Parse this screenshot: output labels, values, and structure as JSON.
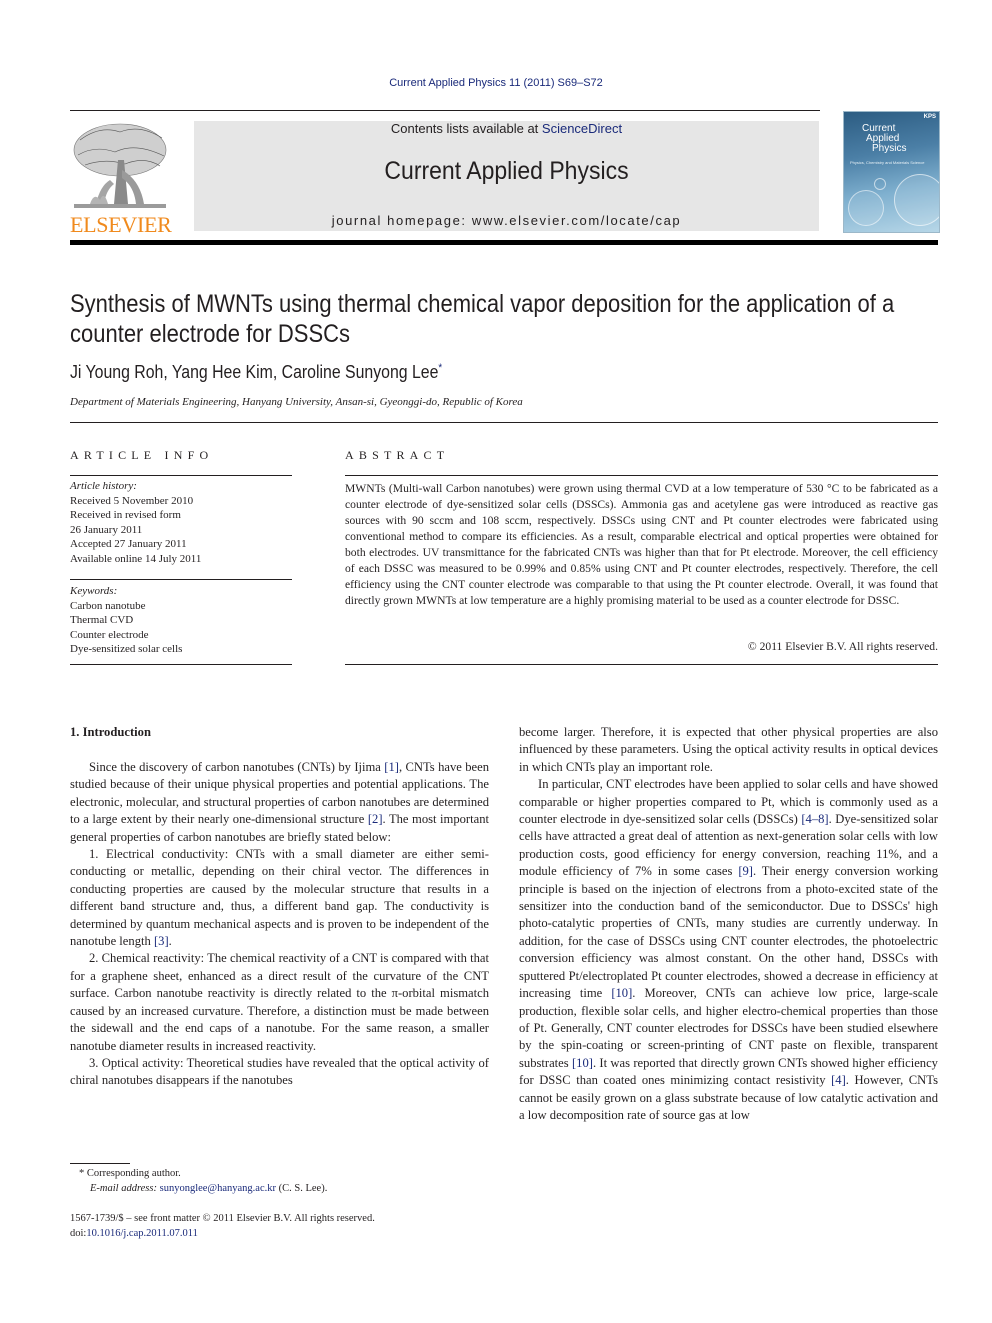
{
  "citation": "Current Applied Physics 11 (2011) S69–S72",
  "masthead": {
    "publisher_logo_text": "ELSEVIER",
    "contents_prefix": "Contents lists available at ",
    "contents_link": "ScienceDirect",
    "journal_title": "Current Applied Physics",
    "homepage_line": "journal homepage: www.elsevier.com/locate/cap",
    "cover": {
      "title_lines": [
        "Current",
        "Applied",
        "Physics"
      ],
      "subtitle": "Physics, Chemistry and Materials Science",
      "badge": "KPS"
    }
  },
  "article": {
    "title": "Synthesis of MWNTs using thermal chemical vapor deposition for the application of a counter electrode for DSSCs",
    "authors": "Ji Young Roh, Yang Hee Kim, Caroline Sunyong Lee",
    "corresponding_mark": "*",
    "affiliation": "Department of Materials Engineering, Hanyang University, Ansan-si, Gyeonggi-do, Republic of Korea"
  },
  "article_info": {
    "label": "ARTICLE INFO",
    "history_header": "Article history:",
    "history": [
      "Received 5 November 2010",
      "Received in revised form",
      "26 January 2011",
      "Accepted 27 January 2011",
      "Available online 14 July 2011"
    ],
    "keywords_header": "Keywords:",
    "keywords": [
      "Carbon nanotube",
      "Thermal CVD",
      "Counter electrode",
      "Dye-sensitized solar cells"
    ]
  },
  "abstract": {
    "label": "ABSTRACT",
    "text": "MWNTs (Multi-wall Carbon nanotubes) were grown using thermal CVD at a low temperature of 530 °C to be fabricated as a counter electrode of dye-sensitized solar cells (DSSCs). Ammonia gas and acetylene gas were introduced as reactive gas sources with 90 sccm and 108 sccm, respectively. DSSCs using CNT and Pt counter electrodes were fabricated using conventional method to compare its efficiencies. As a result, comparable electrical and optical properties were obtained for both electrodes. UV transmittance for the fabricated CNTs was higher than that for Pt electrode. Moreover, the cell efficiency of each DSSC was measured to be 0.99% and 0.85% using CNT and Pt counter electrodes, respectively. Therefore, the cell efficiency using the CNT counter electrode was comparable to that using the Pt counter electrode. Overall, it was found that directly grown MWNTs at low temperature are a highly promising material to be used as a counter electrode for DSSC.",
    "copyright": "© 2011 Elsevier B.V. All rights reserved."
  },
  "introduction": {
    "heading": "1.  Introduction",
    "left_column": [
      {
        "parts": [
          {
            "t": "Since the discovery of carbon nanotubes (CNTs) by Ijima "
          },
          {
            "ref": "[1]"
          },
          {
            "t": ", CNTs have been studied because of their unique physical properties and potential applications. The electronic, molecular, and structural properties of carbon nanotubes are determined to a large extent by their nearly one-dimensional structure "
          },
          {
            "ref": "[2]"
          },
          {
            "t": ". The most important general properties of carbon nanotubes are briefly stated below:"
          }
        ]
      },
      {
        "parts": [
          {
            "t": "1. Electrical conductivity: CNTs with a small diameter are either semi-conducting or metallic, depending on their chiral vector. The differences in conducting properties are caused by the molecular structure that results in a different band structure and, thus, a different band gap. The conductivity is determined by quantum mechanical aspects and is proven to be independent of the nanotube length "
          },
          {
            "ref": "[3]"
          },
          {
            "t": "."
          }
        ]
      },
      {
        "parts": [
          {
            "t": "2. Chemical reactivity: The chemical reactivity of a CNT is compared with that for a graphene sheet, enhanced as a direct result of the curvature of the CNT surface. Carbon nanotube reactivity is directly related to the π-orbital mismatch caused by an increased curvature. Therefore, a distinction must be made between the sidewall and the end caps of a nanotube. For the same reason, a smaller nanotube diameter results in increased reactivity."
          }
        ]
      },
      {
        "parts": [
          {
            "t": "3. Optical activity: Theoretical studies have revealed that the optical activity of chiral nanotubes disappears if the nanotubes"
          }
        ]
      }
    ],
    "right_column": [
      {
        "noindent": true,
        "parts": [
          {
            "t": "become larger. Therefore, it is expected that other physical properties are also influenced by these parameters. Using the optical activity results in optical devices in which CNTs play an important role."
          }
        ]
      },
      {
        "parts": [
          {
            "t": "In particular, CNT electrodes have been applied to solar cells and have showed comparable or higher properties compared to Pt, which is commonly used as a counter electrode in dye-sensitized solar cells (DSSCs) "
          },
          {
            "ref": "[4–8]"
          },
          {
            "t": ". Dye-sensitized solar cells have attracted a great deal of attention as next-generation solar cells with low production costs, good efficiency for energy conversion, reaching 11%, and a module efficiency of 7% in some cases "
          },
          {
            "ref": "[9]"
          },
          {
            "t": ". Their energy conversion working principle is based on the injection of electrons from a photo-excited state of the sensitizer into the conduction band of the semiconductor. Due to DSSCs' high photo-catalytic properties of CNTs, many studies are currently underway. In addition, for the case of DSSCs using CNT counter electrodes, the photoelectric conversion efficiency was almost constant. On the other hand, DSSCs with sputtered Pt/electroplated Pt counter electrodes, showed a decrease in efficiency at increasing time "
          },
          {
            "ref": "[10]"
          },
          {
            "t": ". Moreover, CNTs can achieve low price, large-scale production, flexible solar cells, and higher electro-chemical properties than those of Pt. Generally, CNT counter electrodes for DSSCs have been studied elsewhere by the spin-coating or screen-printing of CNT paste on flexible, transparent substrates "
          },
          {
            "ref": "[10]"
          },
          {
            "t": ". It was reported that directly grown CNTs showed higher efficiency for DSSC than coated ones minimizing contact resistivity "
          },
          {
            "ref": "[4]"
          },
          {
            "t": ". However, CNTs cannot be easily grown on a glass substrate because of low catalytic activation and a low decomposition rate of source gas at low"
          }
        ]
      }
    ]
  },
  "footnote": {
    "mark": "*",
    "corresponding": "Corresponding author.",
    "email_label": "E-mail address: ",
    "email": "sunyonglee@hanyang.ac.kr",
    "email_suffix": " (C. S. Lee)."
  },
  "front_matter": {
    "issn_line": "1567-1739/$ – see front matter © 2011 Elsevier B.V. All rights reserved.",
    "doi_label": "doi:",
    "doi": "10.1016/j.cap.2011.07.011"
  },
  "colors": {
    "link": "#1a2a7a",
    "elsevier_orange": "#f08a1d",
    "masthead_gray": "#e6e6e6"
  }
}
